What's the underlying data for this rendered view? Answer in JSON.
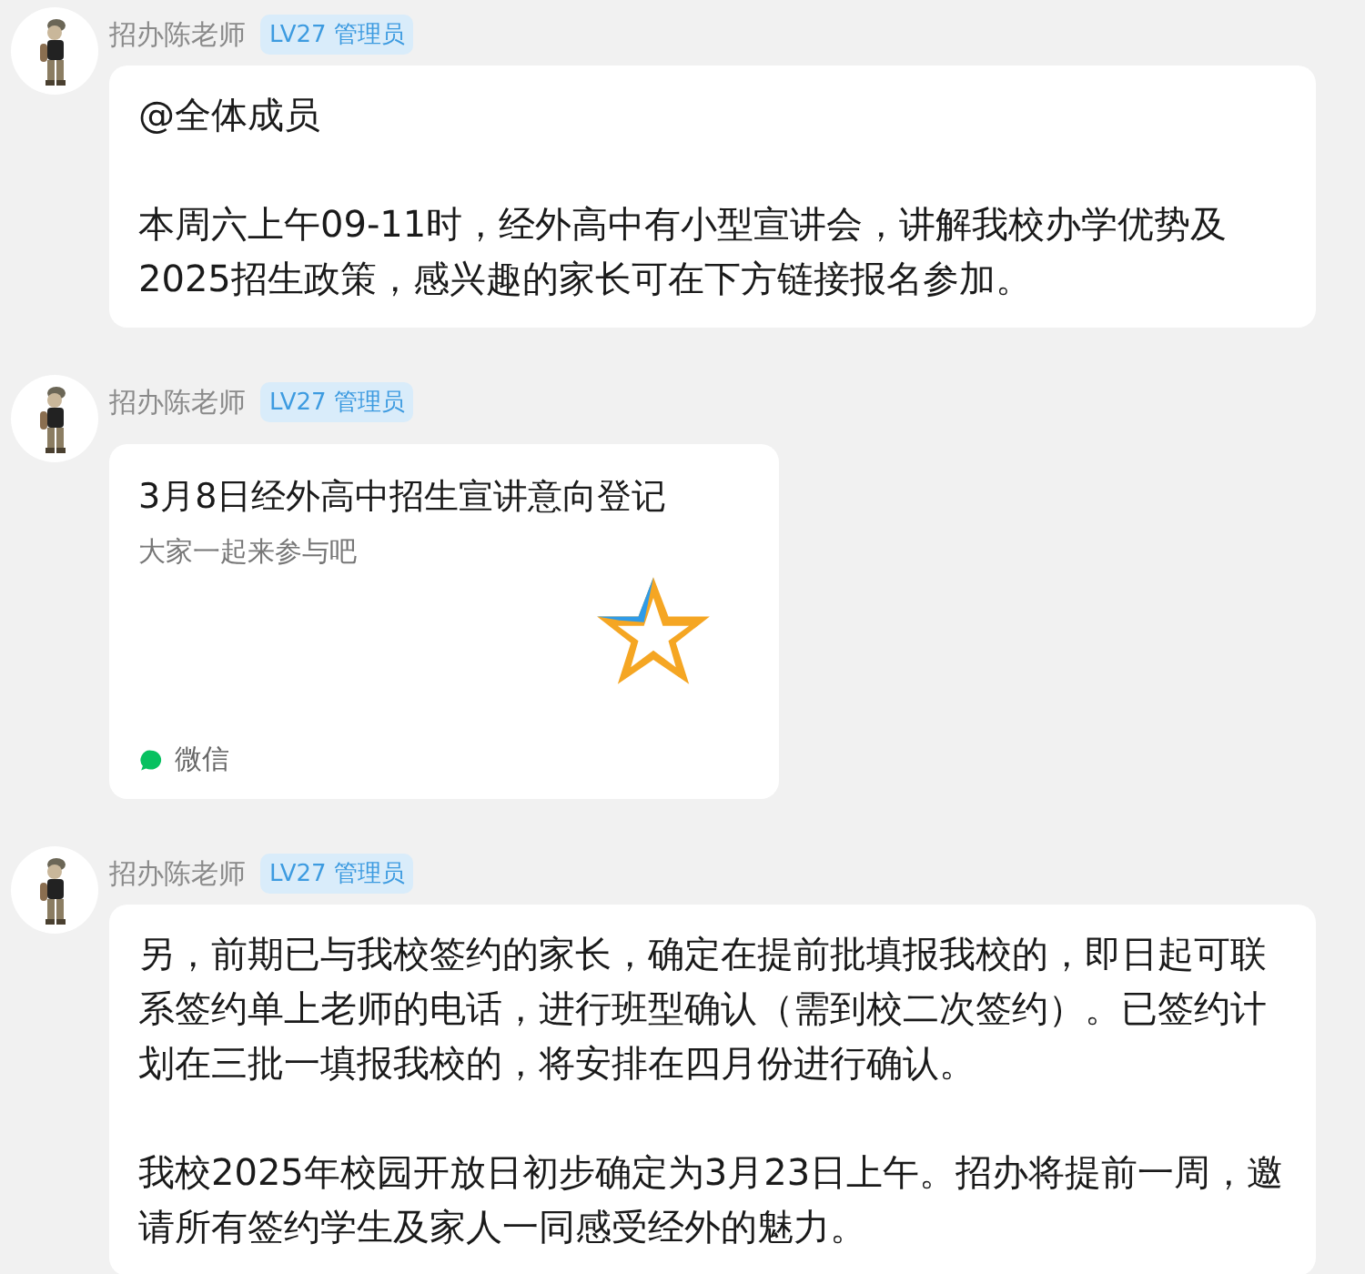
{
  "messages": [
    {
      "sender": "招办陈老师",
      "badge": "LV27 管理员",
      "kind": "text",
      "paragraphs": [
        "@全体成员",
        "本周六上午09-11时，经外高中有小型宣讲会，讲解我校办学优势及2025招生政策，感兴趣的家长可在下方链接报名参加。"
      ]
    },
    {
      "sender": "招办陈老师",
      "badge": "LV27 管理员",
      "kind": "card",
      "title": "3月8日经外高中招生宣讲意向登记",
      "description": "大家一起来参与吧",
      "source": "微信"
    },
    {
      "sender": "招办陈老师",
      "badge": "LV27 管理员",
      "kind": "text",
      "paragraphs": [
        "另，前期已与我校签约的家长，确定在提前批填报我校的，即日起可联系签约单上老师的电话，进行班型确认（需到校二次签约）。已签约计划在三批一填报我校的，将安排在四月份进行确认。",
        "我校2025年校园开放日初步确定为3月23日上午。招办将提前一周，邀请所有签约学生及家人一同感受经外的魅力。"
      ]
    }
  ]
}
